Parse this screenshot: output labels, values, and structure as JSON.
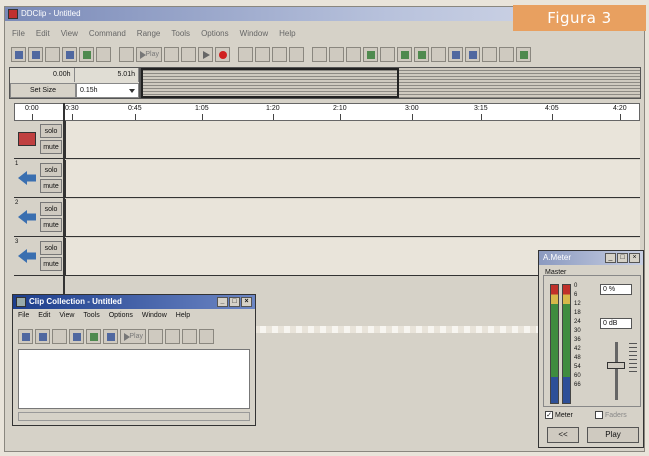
{
  "app": {
    "title": "DDClip - Untitled",
    "badge": "Figura 3"
  },
  "menubar": [
    "File",
    "Edit",
    "View",
    "Command",
    "Range",
    "Tools",
    "Options",
    "Window",
    "Help"
  ],
  "toolbar": {
    "play_label": "Play"
  },
  "time_panel": {
    "start": "0.00h",
    "end": "5.01h",
    "set_size_label": "Set Size",
    "duration_value": "0.15h"
  },
  "ruler": {
    "ticks": [
      "0:00",
      "0:30",
      "0:45",
      "1:05",
      "1:20",
      "2:10",
      "3:00",
      "3:15",
      "4:05",
      "4:20"
    ]
  },
  "tracks": [
    {
      "type": "video",
      "number": "",
      "solo": "solo",
      "mute": "mute"
    },
    {
      "type": "audio",
      "number": "1",
      "solo": "solo",
      "mute": "mute"
    },
    {
      "type": "audio",
      "number": "2",
      "solo": "solo",
      "mute": "mute"
    },
    {
      "type": "audio",
      "number": "3",
      "solo": "solo",
      "mute": "mute"
    }
  ],
  "clip_collection": {
    "title": "Clip Collection - Untitled",
    "menubar": [
      "File",
      "Edit",
      "View",
      "Tools",
      "Options",
      "Window",
      "Help"
    ],
    "play_label": "Play"
  },
  "meter": {
    "title": "A.Meter",
    "master_label": "Master",
    "scale": [
      "0",
      "6",
      "12",
      "18",
      "24",
      "30",
      "36",
      "42",
      "48",
      "54",
      "60",
      "66"
    ],
    "pan_value": "0",
    "pan_unit": "%",
    "gain_value": "0",
    "gain_unit": "dB",
    "meter_checkbox": "Meter",
    "faders_checkbox": "Faders",
    "back_button": "<<",
    "play_button": "Play"
  }
}
